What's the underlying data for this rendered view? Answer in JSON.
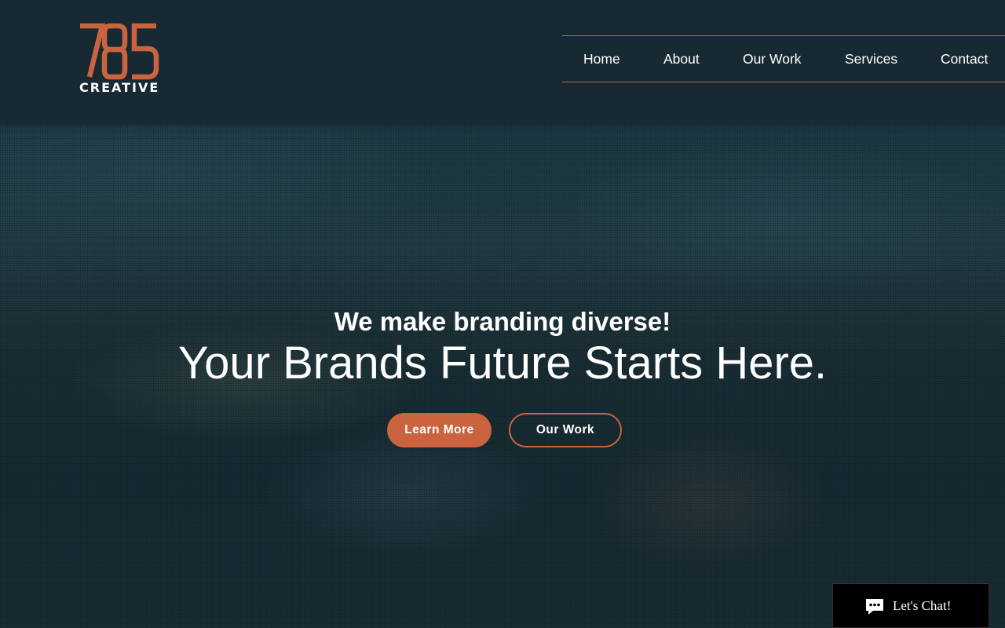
{
  "brand": {
    "logo_number": "785",
    "logo_word": "CREATIVE",
    "accent_color": "#c9643e",
    "header_bg": "#172a33"
  },
  "nav": {
    "items": [
      {
        "label": "Home"
      },
      {
        "label": "About"
      },
      {
        "label": "Our Work"
      },
      {
        "label": "Services"
      },
      {
        "label": "Contact"
      }
    ]
  },
  "hero": {
    "tagline": "We make branding diverse!",
    "headline": "Your Brands Future Starts Here.",
    "primary_button": "Learn More",
    "secondary_button": "Our Work"
  },
  "chat": {
    "label": "Let's Chat!",
    "icon": "chat-bubble-icon"
  }
}
